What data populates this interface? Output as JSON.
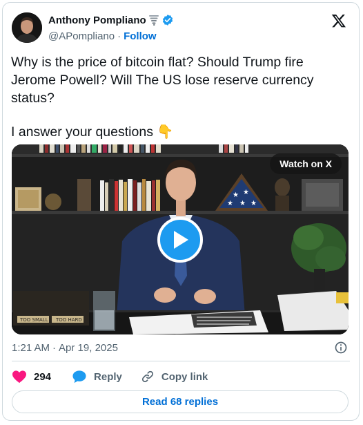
{
  "author": {
    "name": "Anthony Pompliano",
    "handle": "@APompliano",
    "separator": "·",
    "follow_label": "Follow"
  },
  "tweet": {
    "line1": "Why is the price of bitcoin flat? Should Trump fire Jerome Powell? Will The US lose reserve currency status?",
    "line2": "I answer your questions 👇"
  },
  "media": {
    "watch_label": "Watch on X"
  },
  "meta": {
    "time": "1:21 AM",
    "separator": "·",
    "date": "Apr 19, 2025"
  },
  "actions": {
    "likes": "294",
    "reply_label": "Reply",
    "copy_label": "Copy link"
  },
  "replies": {
    "label": "Read 68 replies"
  },
  "colors": {
    "accent": "#1d9bf0",
    "link": "#006fd6",
    "heart": "#f91880",
    "muted": "#536471"
  }
}
